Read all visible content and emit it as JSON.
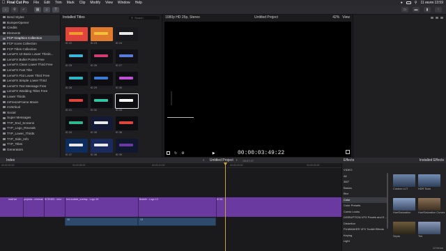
{
  "menubar": {
    "app_name": "Final Cut Pro",
    "items": [
      "File",
      "Edit",
      "Trim",
      "Mark",
      "Clip",
      "Modify",
      "View",
      "Window",
      "Help"
    ],
    "datetime": "11 июля 13:59"
  },
  "sidebar": {
    "items": [
      {
        "label": "Bend Styles"
      },
      {
        "label": "BumperOpener"
      },
      {
        "label": "Credits"
      },
      {
        "label": "Elements"
      },
      {
        "label": "FCP Graphics Collection",
        "selected": true
      },
      {
        "label": "FCP Icons Collection"
      },
      {
        "label": "FCP Titles Collection"
      },
      {
        "label": "LenoFX 10 Basic Lower Thirds..."
      },
      {
        "label": "LenoFX Bullet Points Free"
      },
      {
        "label": "LenoFX Clean Lower Third Free"
      },
      {
        "label": "LenoFX Fast Title"
      },
      {
        "label": "LenoFX Flat Lower Third Free"
      },
      {
        "label": "LenoFX Simple Lower Third"
      },
      {
        "label": "LenoFX Text Message Free"
      },
      {
        "label": "LenoFX Wedding Titles Free"
      },
      {
        "label": "Lower Thirds"
      },
      {
        "label": "mFreezeFrame Movie"
      },
      {
        "label": "mVertical"
      },
      {
        "label": "Social"
      },
      {
        "label": "Super Messages"
      },
      {
        "label": "TYP_End_Screens"
      },
      {
        "label": "TYP_Logo_Reveals"
      },
      {
        "label": "TYP_Lower_Thirds"
      },
      {
        "label": "TYP_Side_Info"
      },
      {
        "label": "TYP_Titles"
      },
      {
        "label": "Generators"
      }
    ]
  },
  "browser": {
    "title": "Installed Titles",
    "search_placeholder": "Search",
    "thumbs": [
      {
        "label": "ID 22"
      },
      {
        "label": "ID 23"
      },
      {
        "label": "ID 24"
      },
      {
        "label": "ID 25"
      },
      {
        "label": "ID 26"
      },
      {
        "label": "ID 27"
      },
      {
        "label": "ID 28"
      },
      {
        "label": "ID 29"
      },
      {
        "label": "ID 30"
      },
      {
        "label": "ID 31"
      },
      {
        "label": "ID 32"
      },
      {
        "label": "ID 33"
      },
      {
        "label": "ID 34"
      },
      {
        "label": "ID 35"
      },
      {
        "label": "ID 36"
      },
      {
        "label": "ID 37"
      },
      {
        "label": "ID 38"
      },
      {
        "label": "ID 39"
      }
    ]
  },
  "viewer": {
    "format": "1080p HD 25p, Stereo",
    "project": "Untitled Project",
    "zoom": "42%",
    "view_label": "View",
    "timecode": "00:00:03:49:22"
  },
  "timeline": {
    "index_label": "Index",
    "project": "Untitled Project",
    "duration": "00:07:07",
    "ruler": [
      "00:00:00:00",
      "00:00:05:00",
      "00:00:10:00",
      "00:00:15:00",
      "00:00:20:00",
      "00:00:25:00"
    ],
    "clip_labels": [
      "ImAHat",
      "projects - minimal",
      "SCENES - intro",
      "webedit - trim",
      "text-bubble_overlay - Logo 16",
      "Bubble - Logo 13",
      "ID 63"
    ],
    "audio_labels": [
      "16",
      "13"
    ]
  },
  "effects": {
    "title": "Effects",
    "installed_label": "Installed Effects",
    "items": [
      {
        "label": "VIDEO"
      },
      {
        "label": "All"
      },
      {
        "label": "360°"
      },
      {
        "label": "Basics"
      },
      {
        "label": "Blur"
      },
      {
        "label": "Color",
        "selected": true
      },
      {
        "label": "Color Presets"
      },
      {
        "label": "Comic Looks"
      },
      {
        "label": "DISRUPTION VFX Panels and E..."
      },
      {
        "label": "Distortion"
      },
      {
        "label": "FILMMAKER VFX Toolkit Effects"
      },
      {
        "label": "Keying"
      },
      {
        "label": "Light"
      }
    ],
    "thumbs": [
      {
        "label": "Custom LUT"
      },
      {
        "label": "HDR Tools"
      },
      {
        "label": "Hue/Saturation"
      },
      {
        "label": "Hue/Saturation Curves"
      },
      {
        "label": "Sepia"
      },
      {
        "label": "Tint"
      }
    ],
    "count": "12 items"
  }
}
